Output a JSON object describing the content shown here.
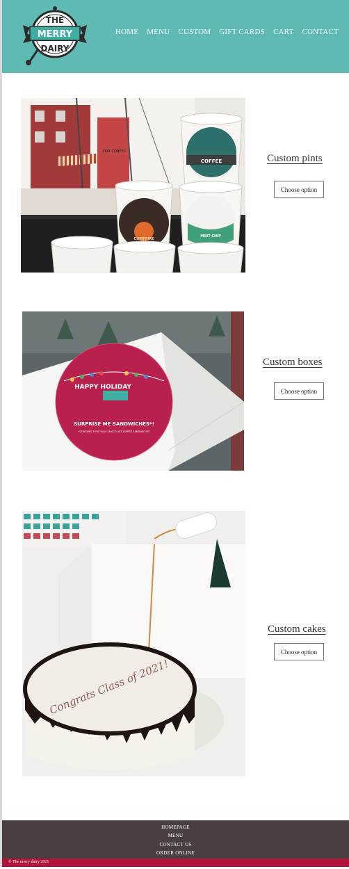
{
  "brand": {
    "logo_lines": [
      "THE",
      "MERRY",
      "DAIRY"
    ],
    "colors": {
      "header": "#5fbab3",
      "footer": "#4a3f3f",
      "copyright_bar": "#b0143a"
    }
  },
  "nav": {
    "items": [
      "HOME",
      "MENU",
      "CUSTOM",
      "GIFT CARDS",
      "CART",
      "CONTACT"
    ]
  },
  "products": [
    {
      "title": "Custom pints",
      "button_label": "Choose option",
      "image_labels": {
        "pint_top": "COFFEE",
        "pint_left": "COMPFIRE",
        "pint_right": "MINT CHIP",
        "shop_sign": "FAIR CONFEC"
      }
    },
    {
      "title": "Custom boxes",
      "button_label": "Choose option",
      "image_labels": {
        "sticker_top": "HAPPY HOLIDAY",
        "sticker_mid": "SURPRISE ME SANDWICHES*!",
        "sticker_small": "*CONTAINS FOUR HALF CHOCOLATE DIPPED SANDWICHES"
      }
    },
    {
      "title": "Custom cakes",
      "button_label": "Choose option",
      "image_labels": {
        "cake_text": "Congrats Class of 2021!"
      }
    }
  ],
  "footer": {
    "links": [
      "HOMEPAGE",
      "MENU",
      "CONTACT US",
      "ORDER ONLINE"
    ],
    "copyright": "© The merry dairy 2021"
  }
}
